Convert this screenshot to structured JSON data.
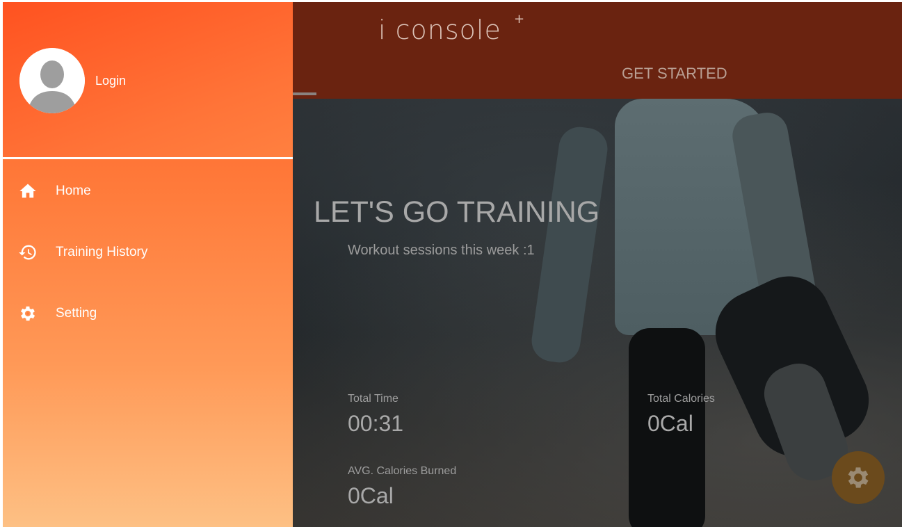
{
  "app": {
    "logo_text": "i console",
    "logo_superscript": "+"
  },
  "tabs": {
    "get_started": "GET STARTED"
  },
  "drawer": {
    "login_label": "Login",
    "items": [
      {
        "label": "Home",
        "icon": "home-icon"
      },
      {
        "label": "Training History",
        "icon": "history-icon"
      },
      {
        "label": "Setting",
        "icon": "gear-icon"
      }
    ]
  },
  "hero": {
    "headline": "LET'S GO TRAINING",
    "sessions_text": "Workout sessions this week :1"
  },
  "stats": {
    "total_time_label": "Total Time",
    "total_time_value": "00:31",
    "total_calories_label": "Total Calories",
    "total_calories_value": "0Cal",
    "avg_calories_label": "AVG. Calories Burned",
    "avg_calories_value": "0Cal"
  },
  "fab": {
    "icon": "gear-icon"
  },
  "colors": {
    "drawer_top": "#ff5a24",
    "drawer_bottom": "#fdc084",
    "appbar": "#6a2310",
    "fab": "#6b4a1c"
  }
}
